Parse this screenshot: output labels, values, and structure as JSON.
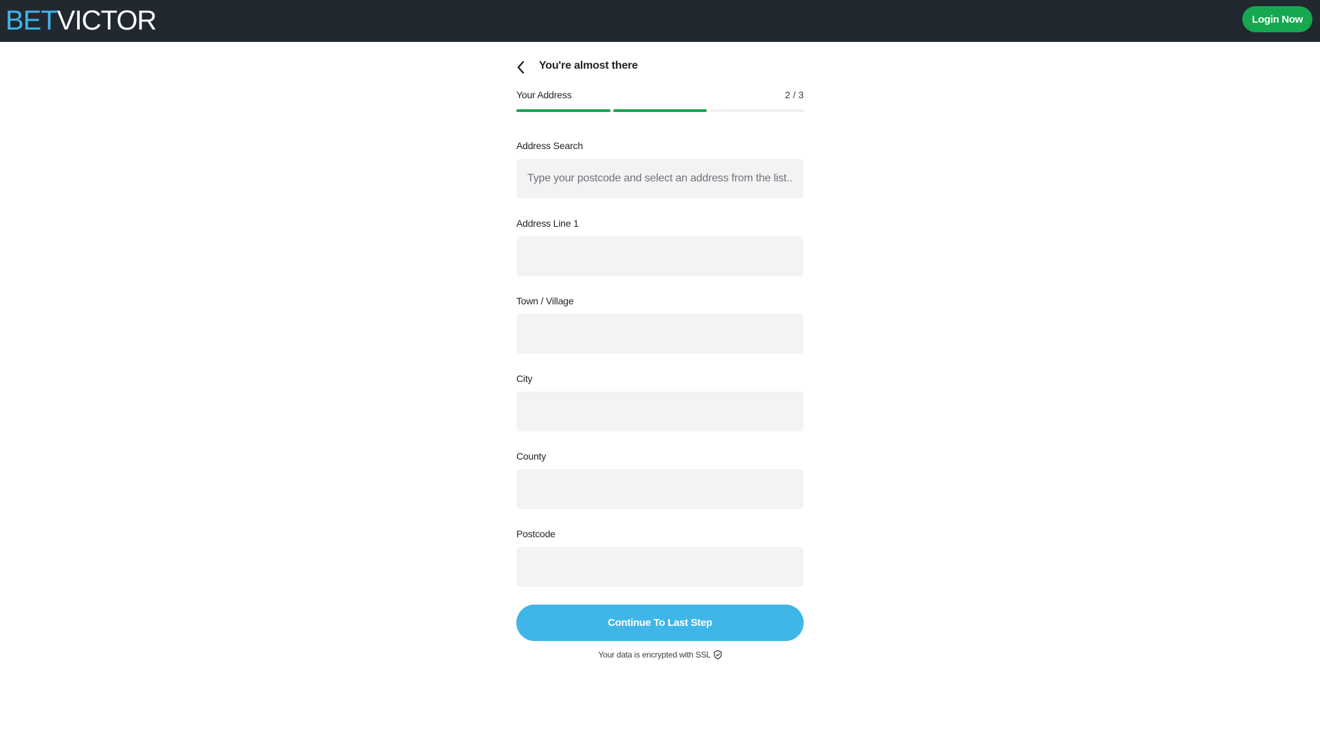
{
  "header": {
    "logo_part1": "BET",
    "logo_part2": "VICTOR",
    "login_label": "Login Now"
  },
  "form": {
    "title": "You're almost there",
    "step_label": "Your Address",
    "step_count": "2 / 3",
    "progress": {
      "completed_steps": 2,
      "total_steps": 3
    },
    "fields": [
      {
        "label": "Address Search",
        "value": "",
        "placeholder": "Type your postcode and select an address from the list..."
      },
      {
        "label": "Address Line 1",
        "value": "",
        "placeholder": ""
      },
      {
        "label": "Town / Village",
        "value": "",
        "placeholder": ""
      },
      {
        "label": "City",
        "value": "",
        "placeholder": ""
      },
      {
        "label": "County",
        "value": "",
        "placeholder": ""
      },
      {
        "label": "Postcode",
        "value": "",
        "placeholder": ""
      }
    ],
    "continue_label": "Continue To Last Step",
    "ssl_note": "Your data is encrypted with SSL"
  },
  "icons": {
    "back": "chevron-left-icon",
    "ssl": "shield-icon"
  },
  "colors": {
    "header_bg": "#212830",
    "brand_blue": "#3fb6e8",
    "brand_green": "#15a84f",
    "input_bg": "#f3f3f4"
  }
}
